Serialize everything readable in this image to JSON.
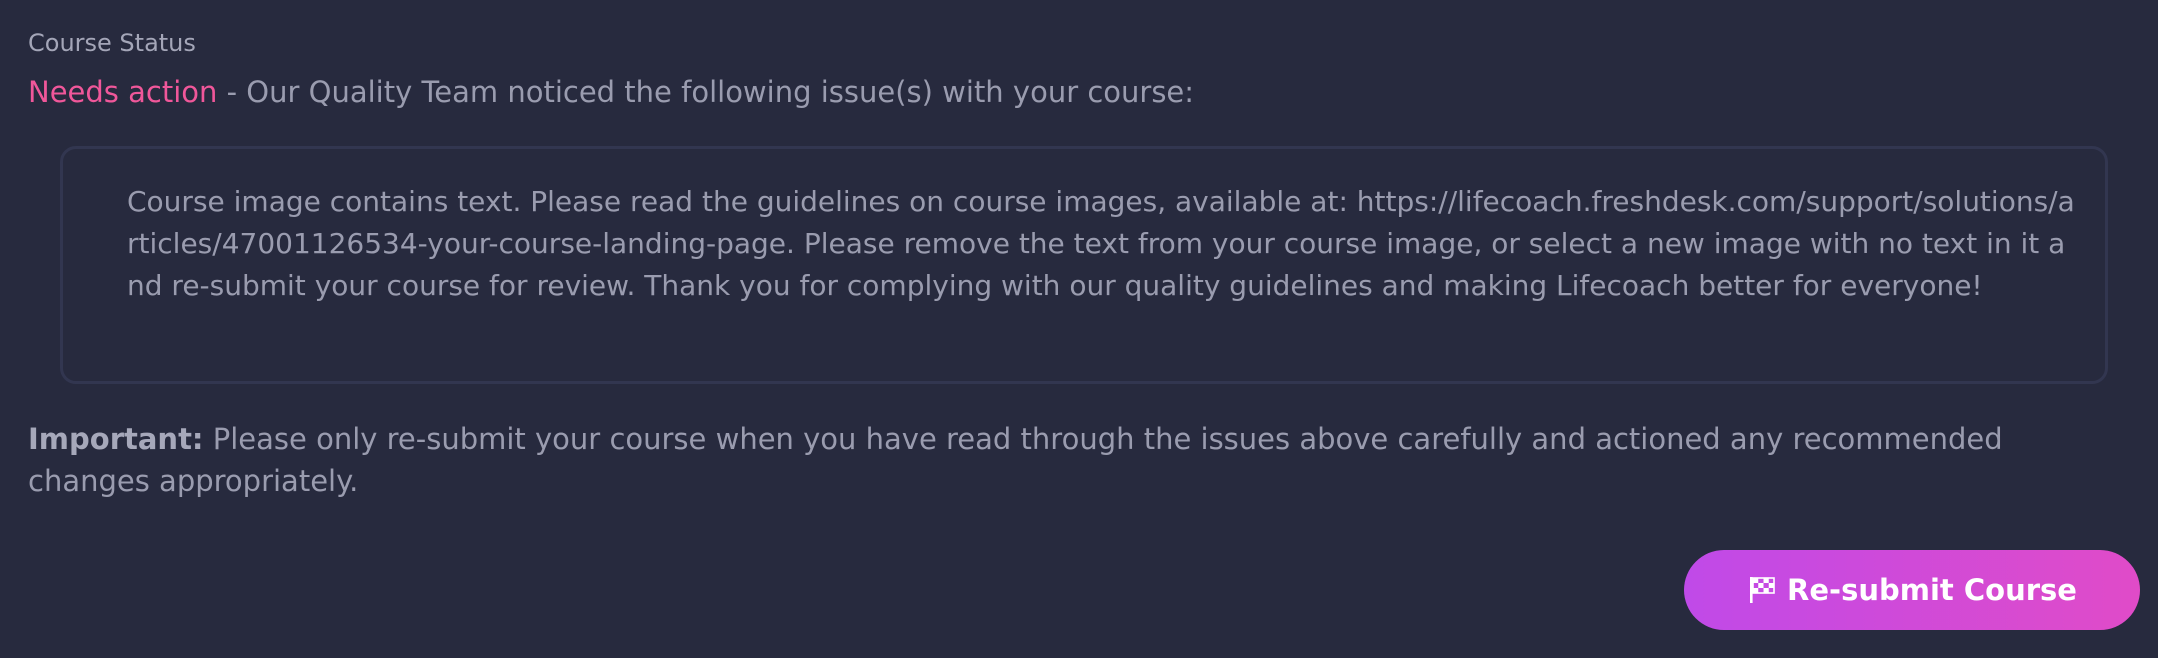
{
  "course_status": {
    "label": "Course Status",
    "value": "Needs action",
    "message": " - Our Quality Team noticed the following issue(s) with your course:"
  },
  "issue": {
    "text": "Course image contains text. Please read the guidelines on course images, available at: https://lifecoach.freshdesk.com/support/solutions/articles/47001126534-your-course-landing-page. Please remove the text from your course image, or select a new image with no text in it and re-submit your course for review. Thank you for complying with our quality guidelines and making Lifecoach better for everyone!"
  },
  "important": {
    "prefix": "Important:",
    "text": " Please only re-submit your course when you have read through the issues above carefully and actioned any recommended changes appropriately."
  },
  "resubmit_button": {
    "icon": "checkered-flag-icon",
    "label": "Re-submit Course"
  },
  "colors": {
    "background": "#272a3e",
    "status_accent": "#f0579a",
    "button_gradient_start": "#c04ae8",
    "button_gradient_end": "#e04bc8"
  }
}
